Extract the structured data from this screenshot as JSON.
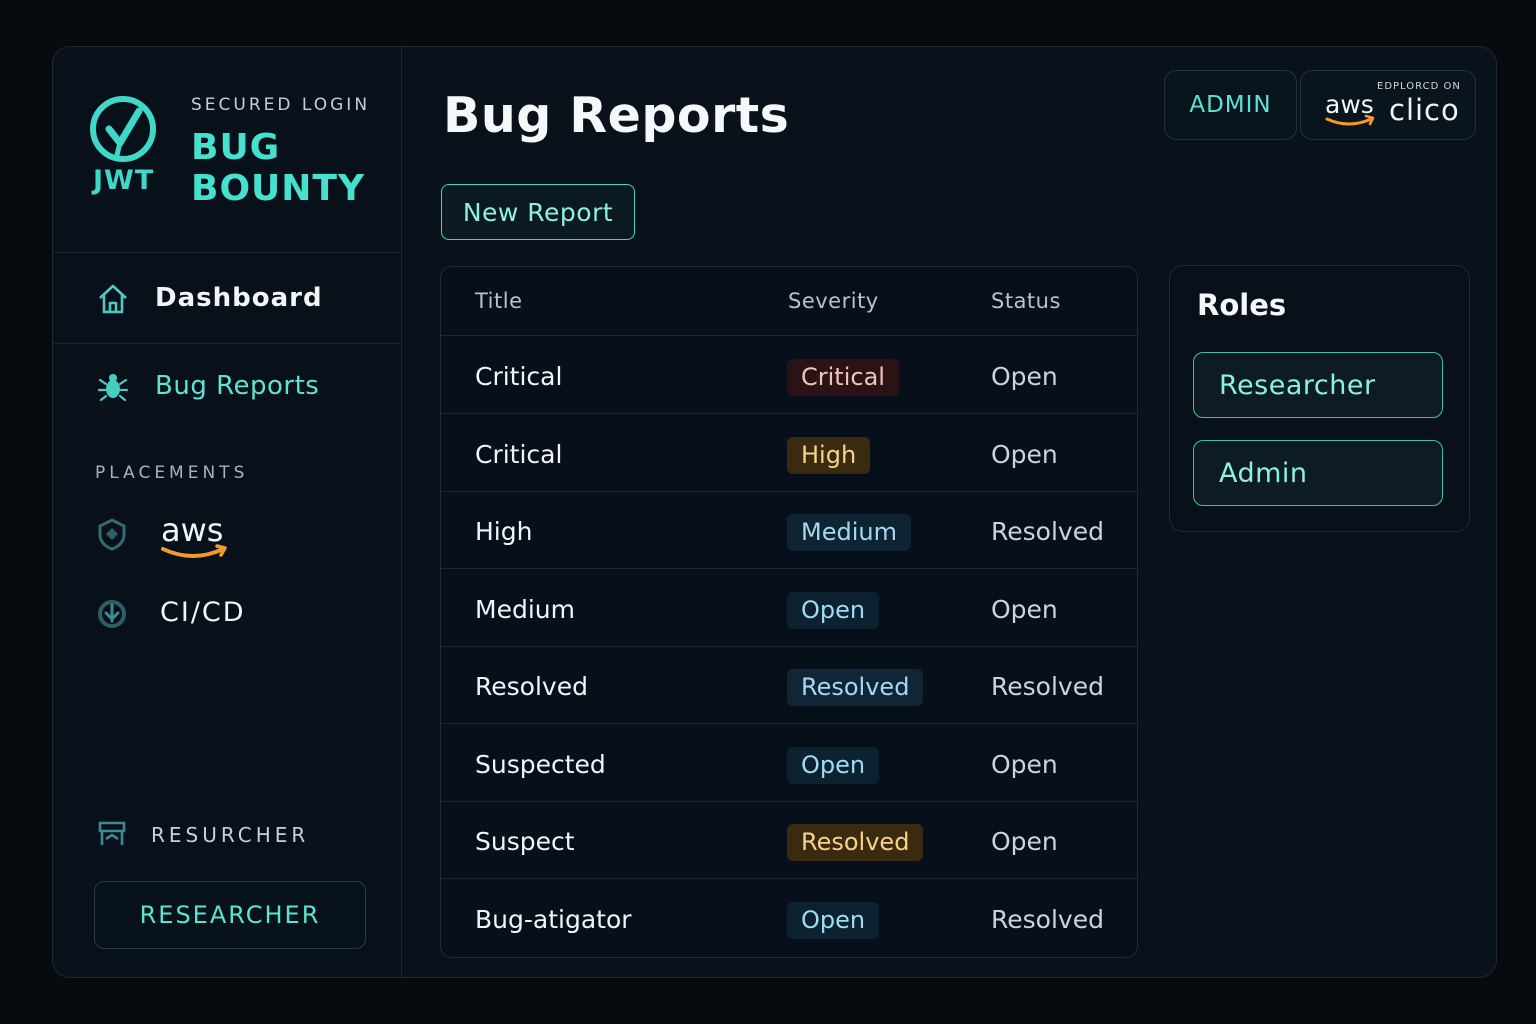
{
  "brand": {
    "logo_text": "JWT",
    "subtitle": "SECURED LOGIN",
    "title": "BUG BOUNTY"
  },
  "nav": {
    "dashboard": "Dashboard",
    "bug_reports": "Bug Reports"
  },
  "placements": {
    "heading": "PLACEMENTS",
    "items": [
      {
        "label": "aws",
        "icon": "aws-logo"
      },
      {
        "label": "CI/CD",
        "icon": "cicd-icon"
      }
    ]
  },
  "user": {
    "role_label": "RESURCHER",
    "role_button": "RESEARCHER"
  },
  "header": {
    "title": "Bug Reports",
    "admin_label": "ADMIN",
    "deploy_caption": "EDPLORCD ON",
    "aws_text": "aws",
    "deploy_target": "clico"
  },
  "actions": {
    "new_report": "New Report"
  },
  "table": {
    "columns": [
      "Title",
      "Severity",
      "Status"
    ],
    "rows": [
      {
        "title": "Critical",
        "severity": "Critical",
        "status": "Open",
        "badge_color": "#f0c3bd"
      },
      {
        "title": "Critical",
        "severity": "High",
        "status": "Open",
        "badge_color": "#f6d28a"
      },
      {
        "title": "High",
        "severity": "Medium",
        "status": "Resolved",
        "badge_color": "#a7d8f0"
      },
      {
        "title": "Medium",
        "severity": "Open",
        "status": "Open",
        "badge_color": "#9fdcf4"
      },
      {
        "title": "Resolved",
        "severity": "Resolved",
        "status": "Resolved",
        "badge_color": "#a9d6f4"
      },
      {
        "title": "Suspected",
        "severity": "Open",
        "status": "Open",
        "badge_color": "#9fdcf4"
      },
      {
        "title": "Suspect",
        "severity": "Resolved",
        "status": "Open",
        "badge_color": "#f6d28a"
      },
      {
        "title": "Bug-atigator",
        "severity": "Open",
        "status": "Resolved",
        "badge_color": "#9fdcf4"
      }
    ]
  },
  "roles": {
    "title": "Roles",
    "items": [
      "Researcher",
      "Admin"
    ]
  },
  "colors": {
    "accent": "#46e0cf",
    "background": "#070b10",
    "panel": "#09111a",
    "aws_orange": "#f29a2e"
  }
}
